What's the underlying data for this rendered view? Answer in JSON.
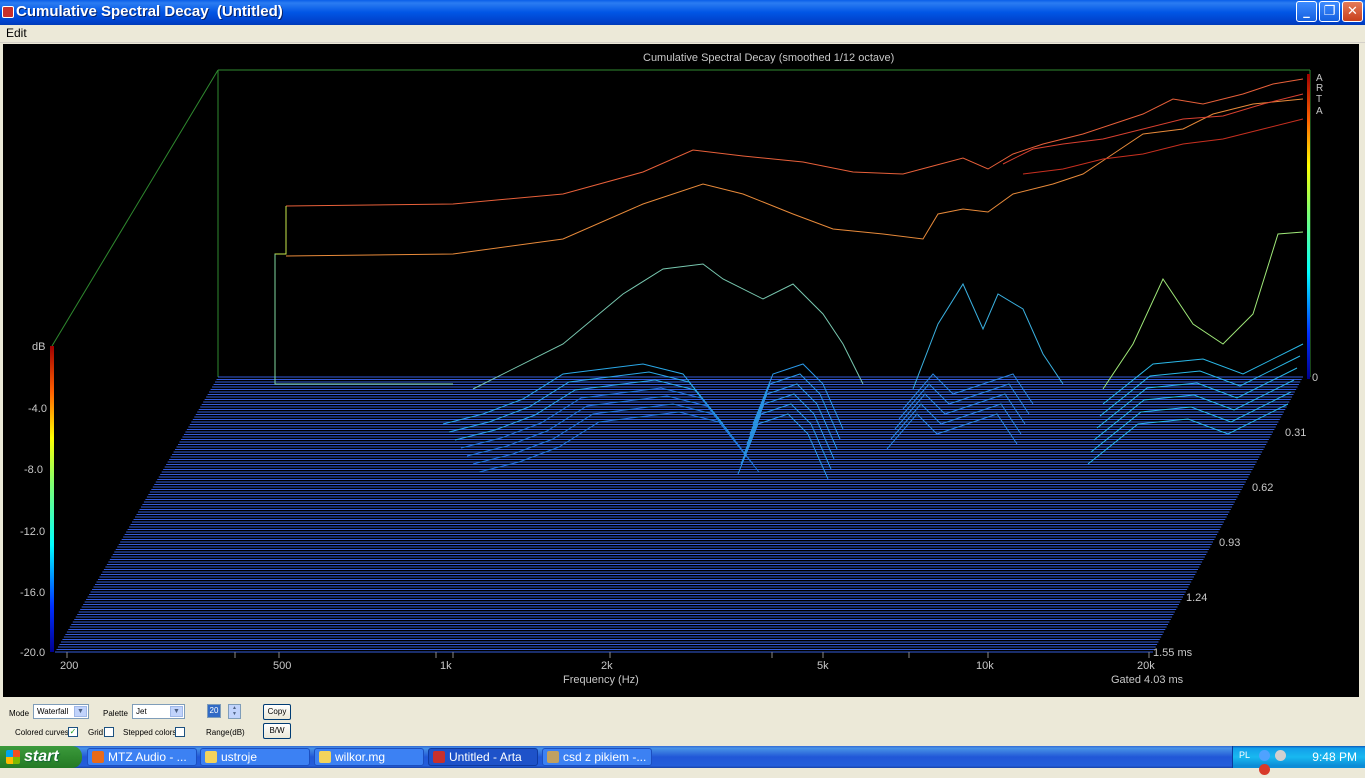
{
  "window": {
    "title": "Cumulative Spectral Decay  (Untitled)",
    "buttons": {
      "minimize": "_",
      "maximize": "❐",
      "close": "✕"
    }
  },
  "menu": {
    "edit": "Edit"
  },
  "plot": {
    "title": "Cumulative Spectral Decay (smoothed 1/12 octave)",
    "logo_letters": [
      "A",
      "R",
      "T",
      "A"
    ],
    "db_label": "dB",
    "db_ticks": [
      "-4.0",
      "-8.0",
      "-12.0",
      "-16.0",
      "-20.0"
    ],
    "freq_ticks": [
      "200",
      "500",
      "1k",
      "2k",
      "5k",
      "10k",
      "20k"
    ],
    "xlabel": "Frequency (Hz)",
    "time_ticks": [
      "0",
      "0.31",
      "0.62",
      "0.93",
      "1.24",
      "1.55 ms"
    ],
    "gated": "Gated 4.03 ms"
  },
  "controls": {
    "mode_label": "Mode",
    "mode_value": "Waterfall",
    "palette_label": "Palette",
    "palette_value": "Jet",
    "range_value": "20",
    "range_label": "Range(dB)",
    "colored_curves_label": "Colored curves",
    "colored_curves_checked": true,
    "grid_label": "Grid",
    "grid_checked": false,
    "stepped_colors_label": "Stepped colors",
    "stepped_colors_checked": false,
    "copy_label": "Copy",
    "bw_label": "B/W"
  },
  "taskbar": {
    "start": "start",
    "tasks": [
      "MTZ Audio - ...",
      "ustroje",
      "wilkor.mg",
      "Untitled - Arta",
      "csd z pikiem -..."
    ],
    "lang": "PL",
    "clock": "9:48 PM"
  },
  "colors": {
    "plot_bg": "#000000",
    "floor_line": "#3f6bff",
    "title_blue": "#0054e3",
    "start_green": "#2f8a2f"
  },
  "icons": [
    "app-icon",
    "minimize-icon",
    "maximize-icon",
    "close-icon",
    "start-flag-icon",
    "checkbox-icon",
    "dropdown-arrow-icon"
  ]
}
